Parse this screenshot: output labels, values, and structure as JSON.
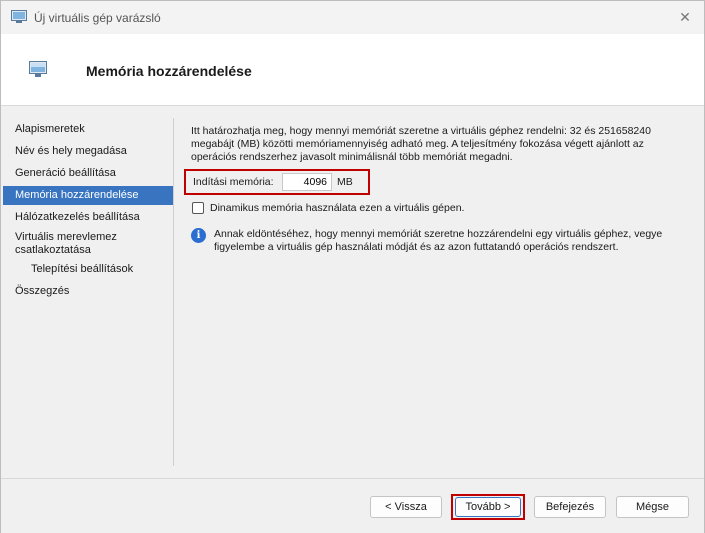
{
  "window": {
    "title": "Új virtuális gép varázsló",
    "close_glyph": "✕"
  },
  "header": {
    "title": "Memória hozzárendelése"
  },
  "sidebar": {
    "items": [
      {
        "label": "Alapismeretek"
      },
      {
        "label": "Név és hely megadása"
      },
      {
        "label": "Generáció beállítása"
      },
      {
        "label": "Memória hozzárendelése",
        "active": true
      },
      {
        "label": "Hálózatkezelés beállítása"
      },
      {
        "label_line1": "Virtuális merevlemez",
        "label_line2": "csatlakoztatása"
      },
      {
        "label": "Telepítési beállítások"
      },
      {
        "label": "Összegzés"
      }
    ]
  },
  "main": {
    "intro": "Itt határozhatja meg, hogy mennyi memóriát szeretne a virtuális géphez rendelni: 32 és 251658240 megabájt (MB) közötti memóriamennyiség adható meg. A teljesítmény fokozása végett ajánlott az operációs rendszerhez javasolt minimálisnál több memóriát megadni.",
    "startup_memory_label": "Indítási memória:",
    "startup_memory_value": "4096",
    "startup_memory_unit": "MB",
    "dynamic_memory_label": "Dinamikus memória használata ezen a virtuális gépen.",
    "dynamic_memory_checked": false,
    "info_glyph": "i",
    "info_text": "Annak eldöntéséhez, hogy mennyi memóriát szeretne hozzárendelni egy virtuális géphez, vegye figyelembe a virtuális gép használati módját és az azon futtatandó operációs rendszert."
  },
  "footer": {
    "back_label": "< Vissza",
    "next_label": "Tovább >",
    "finish_label": "Befejezés",
    "cancel_label": "Mégse"
  },
  "colors": {
    "accent": "#3874c0",
    "highlight_border": "#c00000",
    "info_icon": "#2a6ed1"
  }
}
